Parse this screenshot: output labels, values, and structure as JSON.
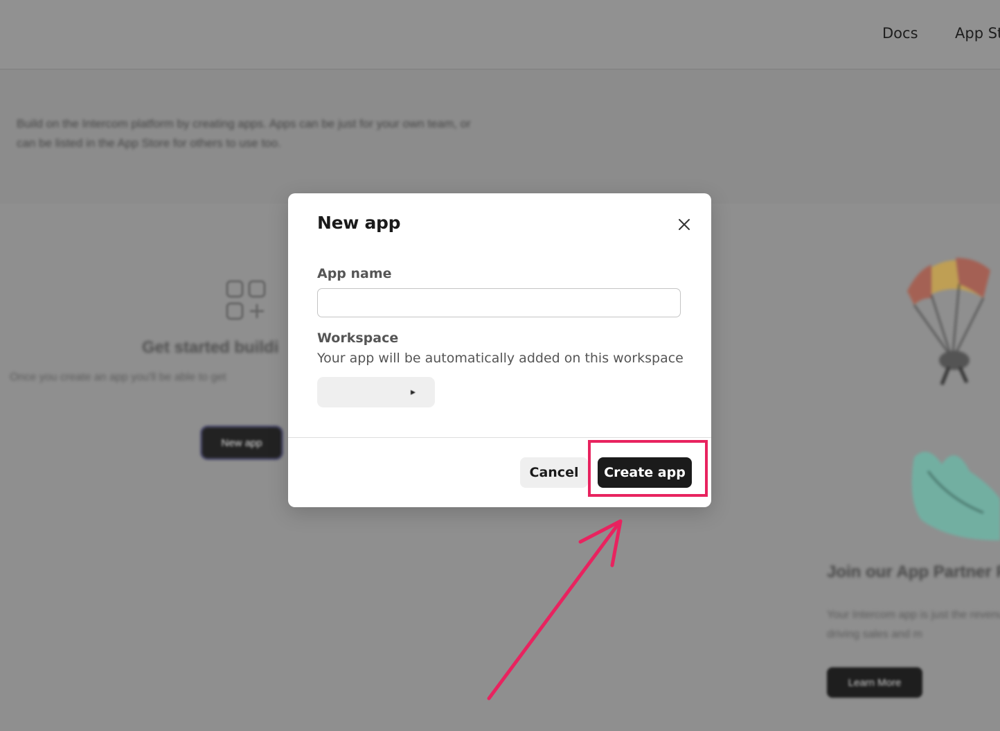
{
  "topnav": {
    "docs": "Docs",
    "app_store": "App St"
  },
  "hero": {
    "description": "Build on the Intercom platform by creating apps. Apps can be just for your own team, or can be listed in the App Store for others to use too."
  },
  "empty_state": {
    "title": "Get started buildi",
    "description": "Once you create an app you'll be able to get",
    "new_app_button": "New app"
  },
  "partner": {
    "title": "Join our App Partner P",
    "description": "Your Intercom app is just the revenue driving sales and m",
    "learn_more_button": "Learn More"
  },
  "modal": {
    "title": "New app",
    "app_name_label": "App name",
    "app_name_value": "",
    "workspace_label": "Workspace",
    "workspace_hint": "Your app will be automatically added on this workspace",
    "cancel_label": "Cancel",
    "create_label": "Create app"
  },
  "annotation": {
    "color": "#e8235f"
  },
  "colors": {
    "overlay_background": "#8f8f8f",
    "primary_button": "#1b1b1b",
    "secondary_button": "#efefef"
  }
}
